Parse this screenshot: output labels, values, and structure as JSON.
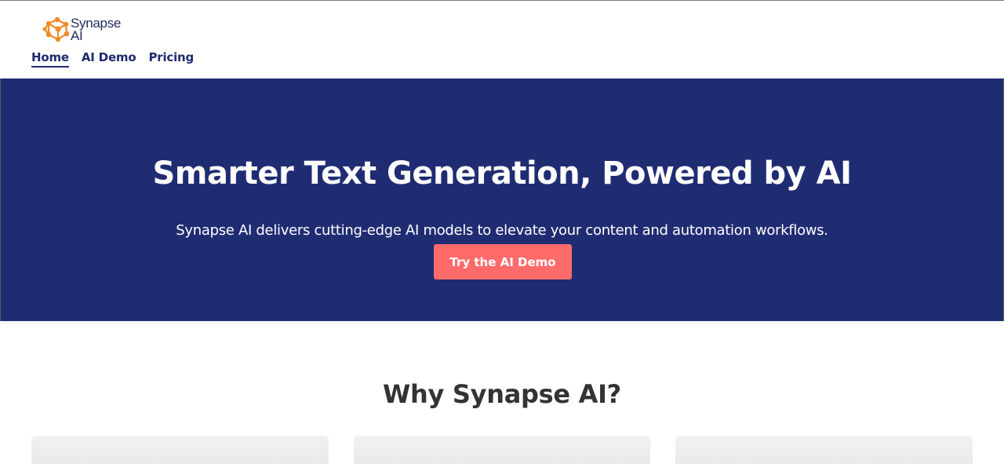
{
  "brand": {
    "name_line1": "Synapse",
    "name_line2": "AI",
    "logo_icon": "network-nodes-icon",
    "logo_color": "#f08a24"
  },
  "nav": {
    "items": [
      {
        "label": "Home",
        "active": true
      },
      {
        "label": "AI Demo",
        "active": false
      },
      {
        "label": "Pricing",
        "active": false
      }
    ]
  },
  "hero": {
    "title": "Smarter Text Generation, Powered by AI",
    "subtitle": "Synapse AI delivers cutting-edge AI models to elevate your content and automation workflows.",
    "cta_label": "Try the AI Demo",
    "background": "#202c72",
    "cta_color": "#ff6b6b"
  },
  "why": {
    "title": "Why Synapse AI?"
  }
}
